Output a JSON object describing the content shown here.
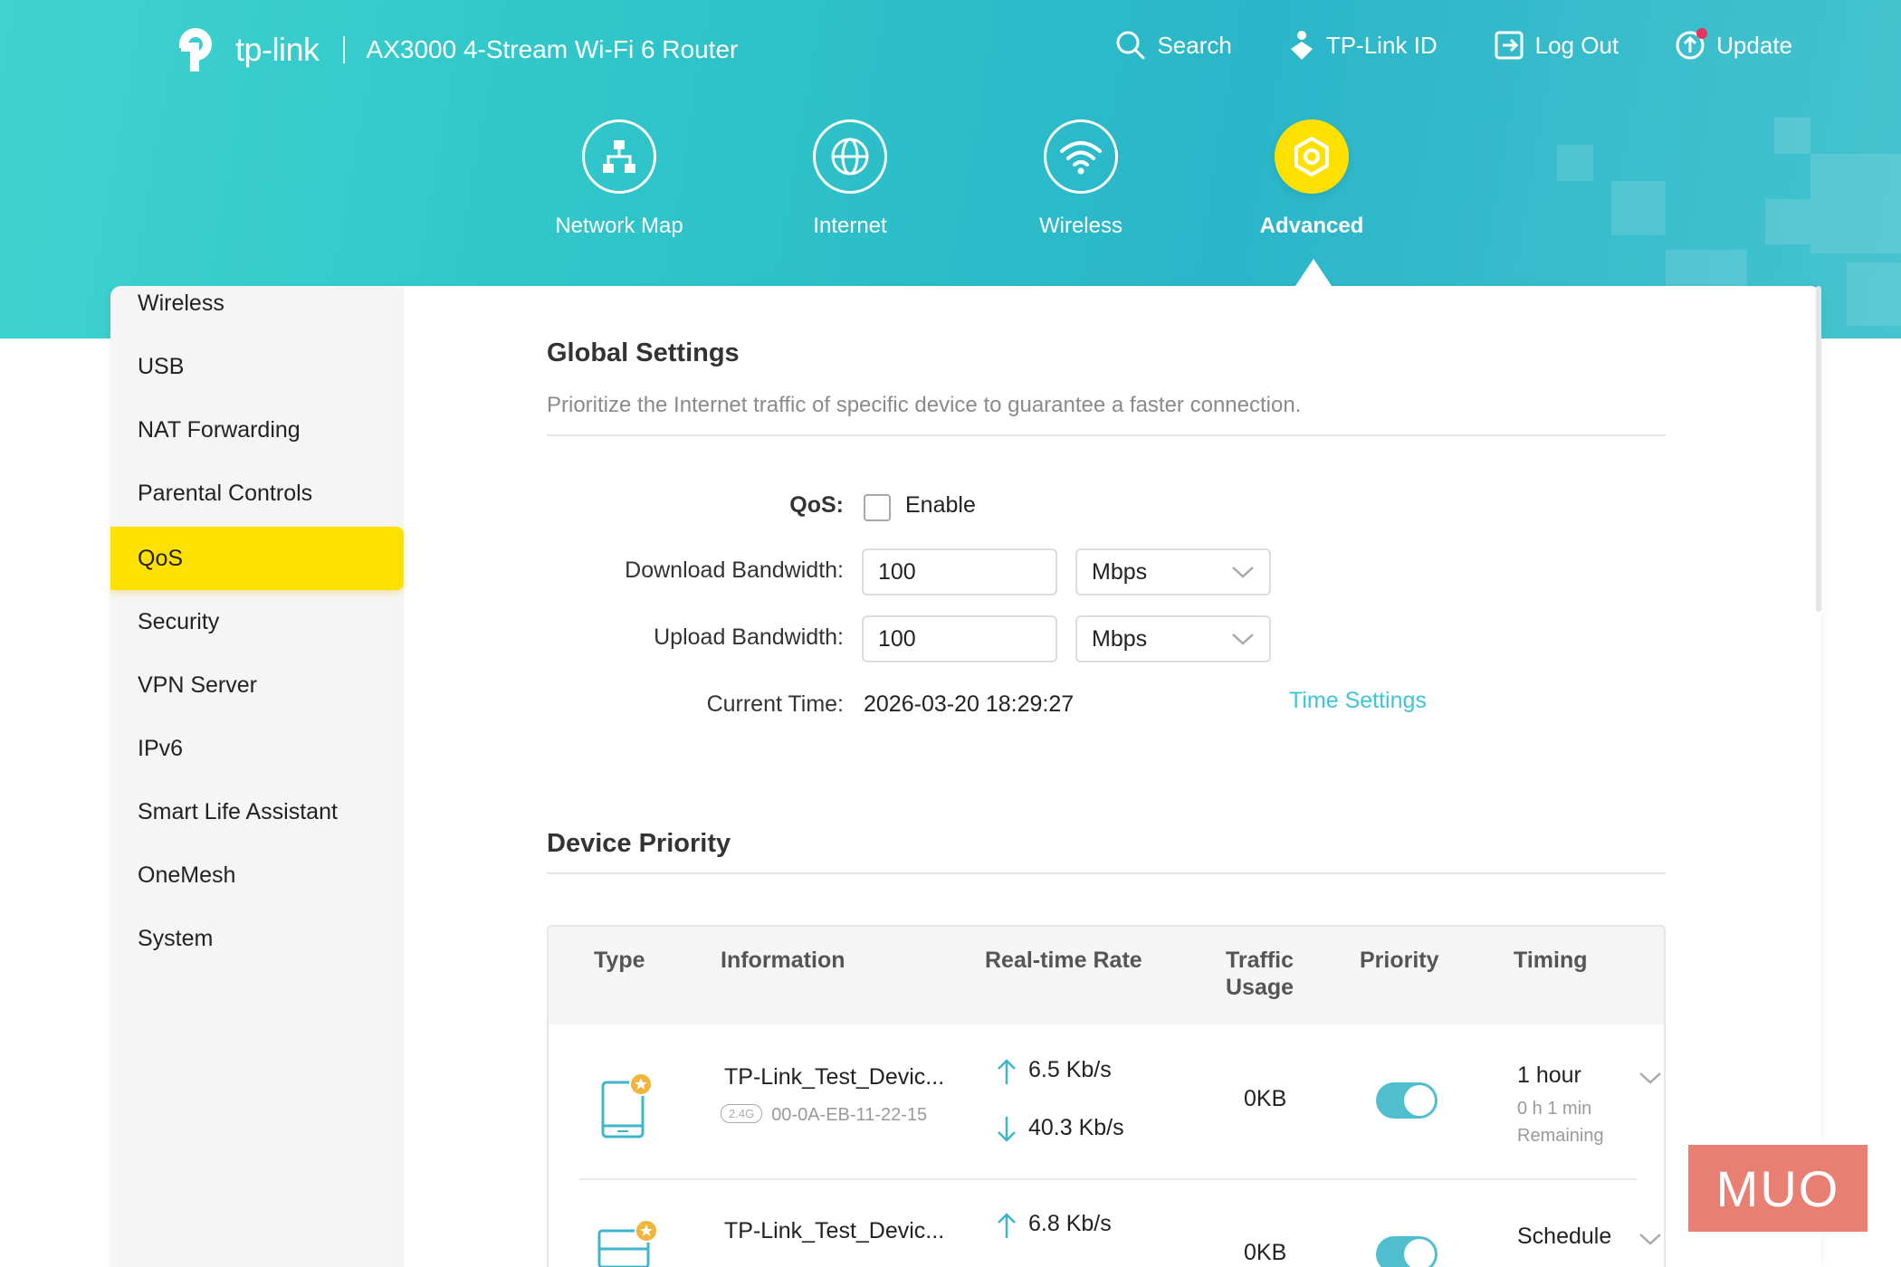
{
  "brand": {
    "logo_text": "tp-link",
    "model": "AX3000 4-Stream Wi-Fi 6 Router"
  },
  "top_actions": {
    "search": "Search",
    "tplink_id": "TP-Link ID",
    "logout": "Log Out",
    "update": "Update"
  },
  "main_nav": [
    {
      "label": "Network Map",
      "icon": "network-map-icon"
    },
    {
      "label": "Internet",
      "icon": "globe-icon"
    },
    {
      "label": "Wireless",
      "icon": "wifi-icon"
    },
    {
      "label": "Advanced",
      "icon": "gear-icon",
      "active": true
    }
  ],
  "sidebar": {
    "items": [
      {
        "label": "Wireless"
      },
      {
        "label": "USB"
      },
      {
        "label": "NAT Forwarding"
      },
      {
        "label": "Parental Controls"
      },
      {
        "label": "QoS",
        "active": true
      },
      {
        "label": "Security"
      },
      {
        "label": "VPN Server"
      },
      {
        "label": "IPv6"
      },
      {
        "label": "Smart Life Assistant"
      },
      {
        "label": "OneMesh"
      },
      {
        "label": "System"
      }
    ]
  },
  "global_settings": {
    "title": "Global Settings",
    "description": "Prioritize the Internet traffic of specific device to guarantee a faster connection.",
    "qos_label": "QoS:",
    "qos_enable_label": "Enable",
    "qos_enabled": false,
    "download_label": "Download Bandwidth:",
    "download_value": "100",
    "download_unit": "Mbps",
    "upload_label": "Upload Bandwidth:",
    "upload_value": "100",
    "upload_unit": "Mbps",
    "current_time_label": "Current Time:",
    "current_time_value": "2026-03-20 18:29:27",
    "time_settings_link": "Time Settings"
  },
  "device_priority": {
    "title": "Device Priority",
    "columns": {
      "type": "Type",
      "information": "Information",
      "rate": "Real-time Rate",
      "traffic_line1": "Traffic",
      "traffic_line2": "Usage",
      "priority": "Priority",
      "timing": "Timing"
    },
    "rows": [
      {
        "name": "TP-Link_Test_Devic...",
        "band": "2.4G",
        "mac": "00-0A-EB-11-22-15",
        "up_rate": "6.5 Kb/s",
        "down_rate": "40.3 Kb/s",
        "traffic": "0KB",
        "priority_on": true,
        "timing": "1 hour",
        "remaining_line1": "0 h 1 min",
        "remaining_line2": "Remaining",
        "icon": "tablet-icon"
      },
      {
        "name": "TP-Link_Test_Devic...",
        "up_rate": "6.8 Kb/s",
        "traffic": "0KB",
        "priority_on": true,
        "timing": "Schedule",
        "icon": "computer-icon"
      }
    ]
  },
  "watermark": "MUO"
}
